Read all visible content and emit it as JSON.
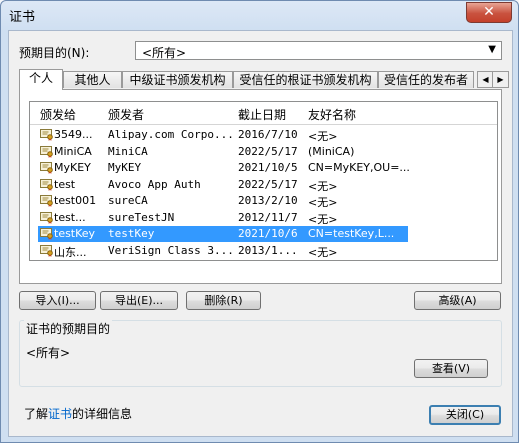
{
  "window": {
    "title": "证书",
    "close_glyph": "✕"
  },
  "purpose": {
    "label": "预期目的(N):",
    "selected": "<所有>",
    "arrow": "▼"
  },
  "tabs": [
    {
      "label": "个人",
      "active": true
    },
    {
      "label": "其他人",
      "active": false
    },
    {
      "label": "中级证书颁发机构",
      "active": false
    },
    {
      "label": "受信任的根证书颁发机构",
      "active": false
    },
    {
      "label": "受信任的发布者",
      "active": false
    }
  ],
  "tab_scroll": {
    "left": "◀",
    "right": "▶"
  },
  "table": {
    "columns": [
      "颁发给",
      "颁发者",
      "截止日期",
      "友好名称"
    ],
    "rows": [
      {
        "issued_to": "3549...",
        "issued_by": "Alipay.com Corpo...",
        "expires": "2016/7/10",
        "friendly": "<无>"
      },
      {
        "issued_to": "MiniCA",
        "issued_by": "MiniCA",
        "expires": "2022/5/17",
        "friendly": "(MiniCA)"
      },
      {
        "issued_to": "MyKEY",
        "issued_by": "MyKEY",
        "expires": "2021/10/5",
        "friendly": "CN=MyKEY,OU=..."
      },
      {
        "issued_to": "test",
        "issued_by": "Avoco App Auth",
        "expires": "2022/5/17",
        "friendly": "<无>"
      },
      {
        "issued_to": "test001",
        "issued_by": "sureCA",
        "expires": "2013/2/10",
        "friendly": "<无>"
      },
      {
        "issued_to": "test...",
        "issued_by": "sureTestJN",
        "expires": "2012/11/7",
        "friendly": "<无>"
      },
      {
        "issued_to": "testKey",
        "issued_by": "testKey",
        "expires": "2021/10/6",
        "friendly": "CN=testKey,L...",
        "selected": true
      },
      {
        "issued_to": "山东...",
        "issued_by": "VeriSign Class 3...",
        "expires": "2013/1...",
        "friendly": "<无>"
      }
    ]
  },
  "buttons": {
    "import": "导入(I)...",
    "export": "导出(E)...",
    "remove": "删除(R)",
    "advanced": "高级(A)",
    "view": "查看(V)",
    "close": "关闭(C)"
  },
  "purposes_group": {
    "title": "证书的预期目的",
    "value": "<所有>"
  },
  "learn_more": {
    "prefix": "了解",
    "link": "证书",
    "suffix": "的详细信息"
  },
  "colors": {
    "selection": "#3399ff",
    "link": "#0066cc",
    "close_button": "#c9523f"
  }
}
